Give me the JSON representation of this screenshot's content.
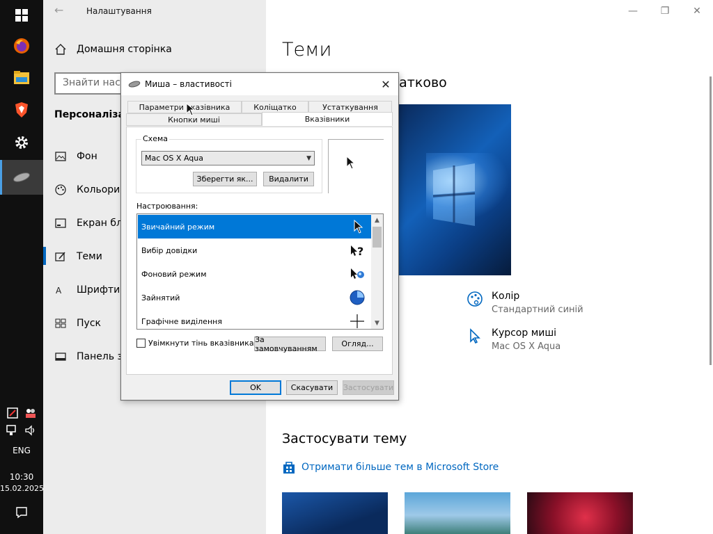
{
  "taskbar": {
    "time": "10:30",
    "date": "15.02.2025",
    "language": "ENG"
  },
  "settings": {
    "window_title": "Налаштування",
    "home_label": "Домашня сторінка",
    "search_placeholder": "Знайти настр",
    "section_title": "Персоналізаці",
    "nav": [
      {
        "label": "Фон",
        "icon": "picture-icon"
      },
      {
        "label": "Кольори",
        "icon": "palette-icon"
      },
      {
        "label": "Екран бло",
        "icon": "lock-screen-icon"
      },
      {
        "label": "Теми",
        "icon": "themes-icon",
        "selected": true
      },
      {
        "label": "Шрифти",
        "icon": "font-icon"
      },
      {
        "label": "Пуск",
        "icon": "start-icon"
      },
      {
        "label": "Панель за",
        "icon": "taskbar-icon"
      }
    ],
    "page_title": "Теми",
    "subheading": "датково",
    "color_prop": {
      "label": "Колір",
      "value": "Стандартний синій"
    },
    "cursor_prop": {
      "label": "Курсор миші",
      "value": "Mac OS X Aqua"
    },
    "apply_heading": "Застосувати тему",
    "store_link": "Отримати більше тем в Microsoft Store"
  },
  "dialog": {
    "title": "Миша – властивості",
    "tabs_row1": [
      "Параметри вказівника",
      "Коліщатко",
      "Устаткування"
    ],
    "tabs_row2": [
      "Кнопки миші",
      "Вказівники"
    ],
    "selected_tab": "Вказівники",
    "scheme_group_label": "Схема",
    "scheme_value": "Mac OS X Aqua",
    "save_as_button": "Зберегти як...",
    "delete_button": "Видалити",
    "customize_label": "Настроювання:",
    "cursor_rows": [
      {
        "label": "Звичайний режим",
        "selected": true,
        "icon": "arrow-cursor-icon"
      },
      {
        "label": "Вибір довідки",
        "icon": "help-cursor-icon"
      },
      {
        "label": "Фоновий режим",
        "icon": "working-cursor-icon"
      },
      {
        "label": "Зайнятий",
        "icon": "busy-cursor-icon"
      },
      {
        "label": "Графічне виділення",
        "icon": "crosshair-cursor-icon"
      }
    ],
    "shadow_checkbox": "Увімкнути тінь вказівника",
    "default_button": "За замовчуванням",
    "browse_button": "Огляд...",
    "ok_button": "OK",
    "cancel_button": "Скасувати",
    "apply_button": "Застосувати"
  },
  "colors": {
    "accent": "#0078d7",
    "link": "#0067c0",
    "taskbar": "#101010"
  }
}
